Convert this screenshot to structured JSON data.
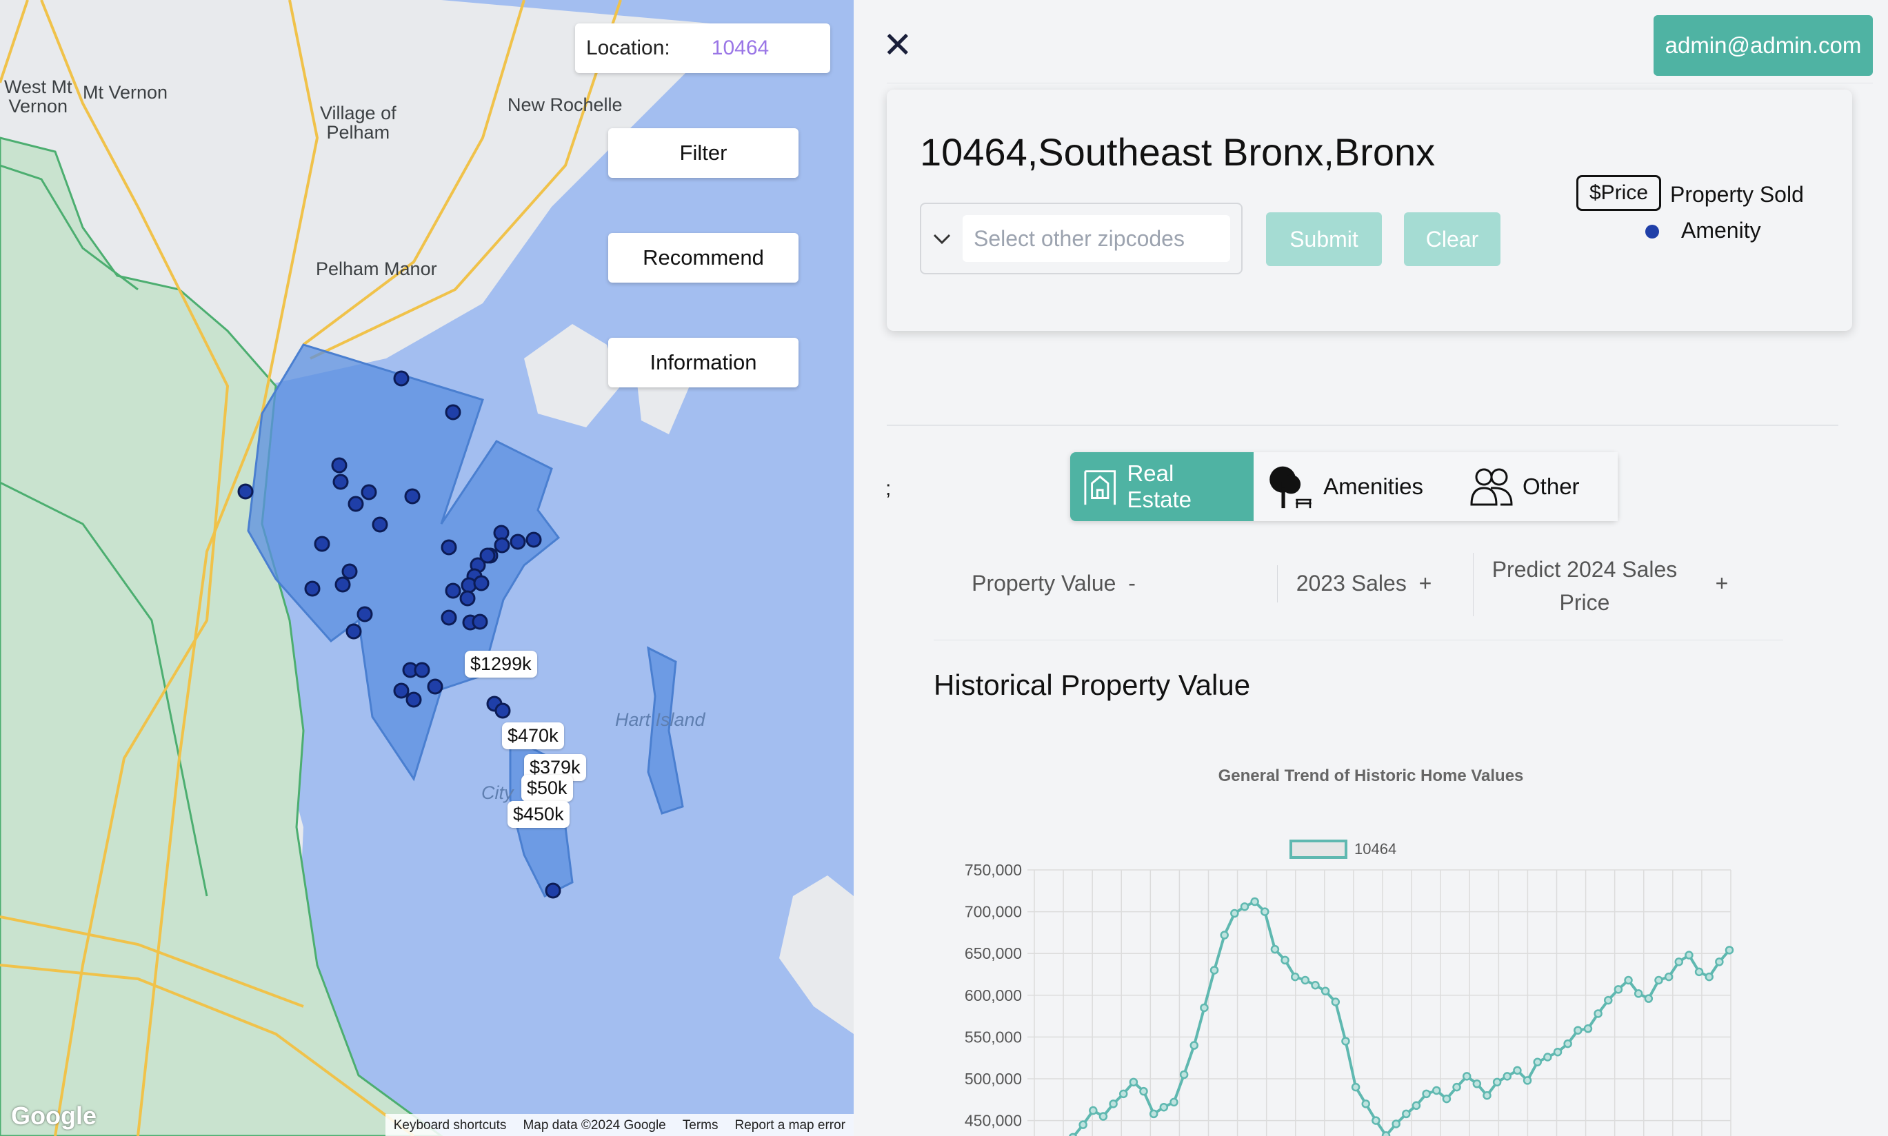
{
  "map": {
    "location_label": "Location:",
    "location_value": "10464",
    "buttons": {
      "filter": "Filter",
      "recommend": "Recommend",
      "information": "Information"
    },
    "place_labels": {
      "west_mt_vernon": "West Mt\nVernon",
      "mt_vernon": "Mt Vernon",
      "village_of_pelham": "Village of\nPelham",
      "new_rochelle": "New Rochelle",
      "pelham_manor": "Pelham Manor",
      "hart_island": "Hart Island",
      "city": "City"
    },
    "price_tags": [
      "$1299k",
      "$470k",
      "$379k",
      "$50k",
      "$450k"
    ],
    "google": "Google",
    "attribution": [
      "Keyboard shortcuts",
      "Map data ©2024 Google",
      "Terms",
      "Report a map error"
    ]
  },
  "panel": {
    "user_email": "admin@admin.com",
    "heading": "10464,Southeast Bronx,Bronx",
    "zip_placeholder": "Select other zipcodes",
    "submit": "Submit",
    "clear": "Clear",
    "legend": {
      "price_box": "$Price",
      "property_sold": "Property Sold",
      "amenity": "Amenity"
    },
    "stray_text": ";",
    "tabs": [
      "Real Estate",
      "Amenities",
      "Other"
    ],
    "columns": [
      {
        "label": "Property Value",
        "sign": "-"
      },
      {
        "label": "2023 Sales",
        "sign": "+"
      },
      {
        "label": "Predict 2024 Sales Price",
        "sign": "+"
      }
    ],
    "section_title": "Historical Property Value"
  },
  "chart_data": {
    "type": "line",
    "title": "General Trend of Historic Home Values",
    "series": [
      {
        "name": "10464",
        "color": "#5fb8b0",
        "values": [
          430000,
          445000,
          462000,
          455000,
          470000,
          482000,
          496000,
          485000,
          458000,
          466000,
          472000,
          505000,
          540000,
          585000,
          630000,
          672000,
          698000,
          706000,
          712000,
          700000,
          655000,
          642000,
          622000,
          618000,
          612000,
          605000,
          592000,
          545000,
          490000,
          470000,
          450000,
          432000,
          446000,
          458000,
          468000,
          482000,
          486000,
          476000,
          490000,
          503000,
          494000,
          480000,
          496000,
          503000,
          510000,
          498000,
          520000,
          526000,
          532000,
          542000,
          558000,
          560000,
          578000,
          594000,
          607000,
          618000,
          602000,
          596000,
          618000,
          622000,
          640000,
          648000,
          628000,
          622000,
          640000,
          654000
        ]
      }
    ],
    "y_ticks": [
      "750,000",
      "700,000",
      "650,000",
      "600,000",
      "550,000",
      "500,000",
      "450,000"
    ],
    "ylim": [
      440000,
      750000
    ]
  },
  "colors": {
    "accent": "#4fb3a3",
    "accent_disabled": "#a5dcd3",
    "marker": "#1f3fa8",
    "zip_fill": "#5b8fe0"
  }
}
